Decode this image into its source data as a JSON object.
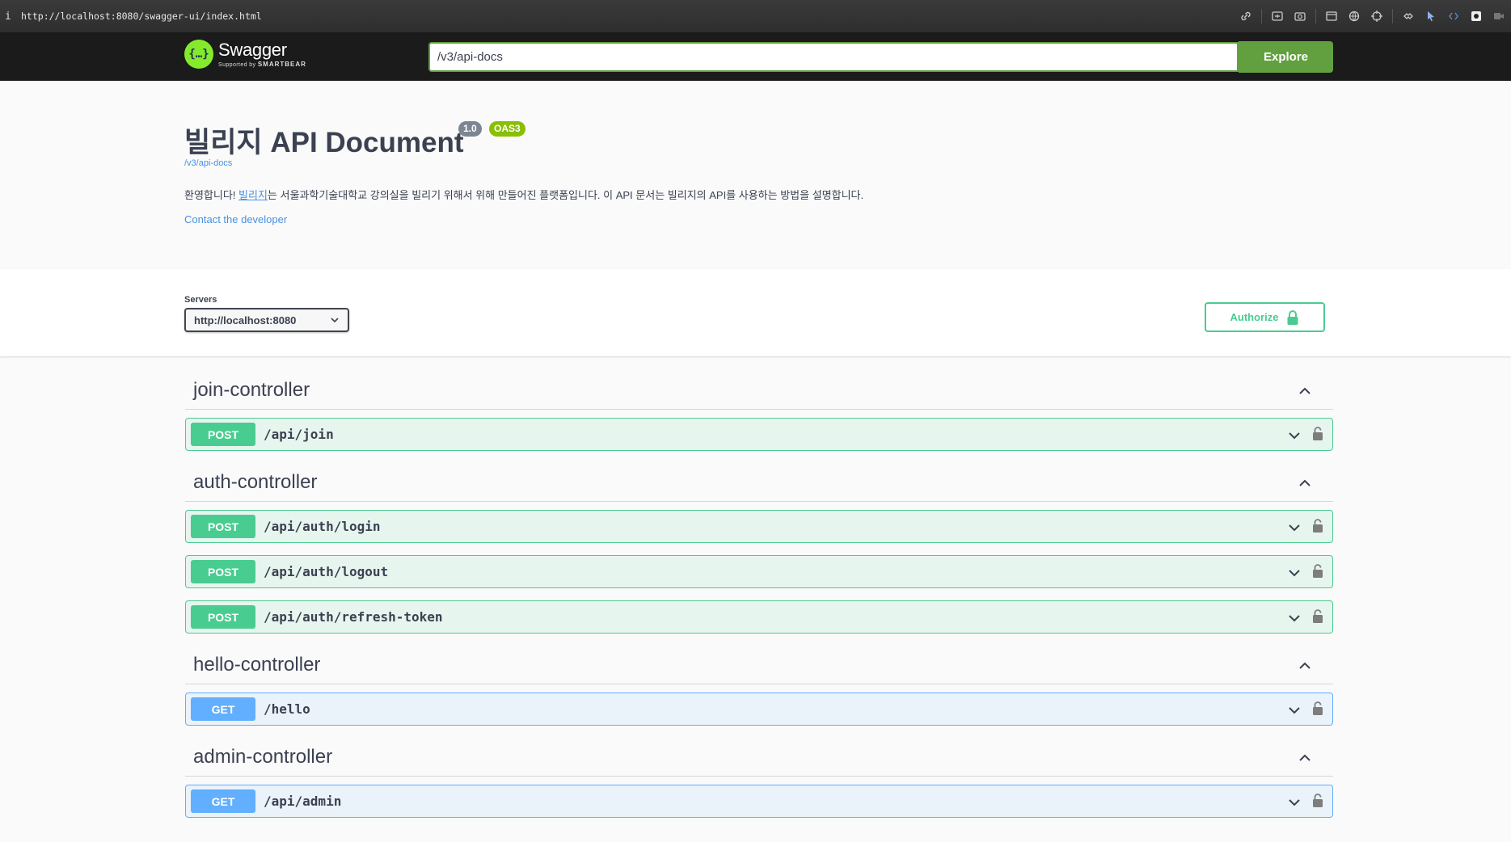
{
  "browser": {
    "info_glyph": "i",
    "url": "http://localhost:8080/swagger-ui/index.html",
    "tool_icons": [
      "link-icon",
      "screenshot-icon",
      "camera-icon",
      "window-icon",
      "globe-icon",
      "crosshair-icon",
      "extension-icon",
      "cursor-icon",
      "code-icon",
      "app-icon",
      "video-icon"
    ]
  },
  "topbar": {
    "logo_glyph": "{…}",
    "logo_title": "Swagger",
    "logo_supported": "Supported by",
    "logo_company": "SMARTBEAR",
    "spec_url_value": "/v3/api-docs",
    "explore_label": "Explore"
  },
  "info": {
    "title": "빌리지 API Document",
    "version": "1.0",
    "oas": "OAS3",
    "spec_link": "/v3/api-docs",
    "desc_prefix": "환영합니다! ",
    "desc_link": "빌리지",
    "desc_suffix": "는 서울과학기술대학교 강의실을 빌리기 위해서 위해 만들어진 플랫폼입니다. 이 API 문서는 빌리지의 API를 사용하는 방법을 설명합니다.",
    "contact": "Contact the developer"
  },
  "servers": {
    "label": "Servers",
    "selected": "http://localhost:8080",
    "authorize_label": "Authorize"
  },
  "colors": {
    "post": "#49cc90",
    "get": "#61affe",
    "explore": "#62a03f",
    "topbar": "#1b1b1b"
  },
  "tags": [
    {
      "name": "join-controller",
      "operations": [
        {
          "method": "POST",
          "path": "/api/join"
        }
      ]
    },
    {
      "name": "auth-controller",
      "operations": [
        {
          "method": "POST",
          "path": "/api/auth/login"
        },
        {
          "method": "POST",
          "path": "/api/auth/logout"
        },
        {
          "method": "POST",
          "path": "/api/auth/refresh-token"
        }
      ]
    },
    {
      "name": "hello-controller",
      "operations": [
        {
          "method": "GET",
          "path": "/hello"
        }
      ]
    },
    {
      "name": "admin-controller",
      "operations": [
        {
          "method": "GET",
          "path": "/api/admin"
        }
      ]
    }
  ]
}
